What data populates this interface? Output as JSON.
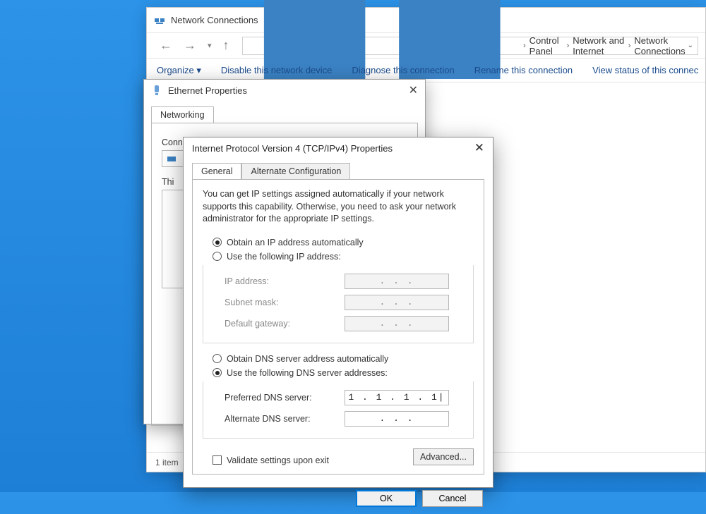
{
  "mainWindow": {
    "title": "Network Connections",
    "breadcrumb": {
      "root": "Control Panel",
      "mid": "Network and Internet",
      "leaf": "Network Connections"
    },
    "toolbar": {
      "organize": "Organize ▾",
      "disable": "Disable this network device",
      "diagnose": "Diagnose this connection",
      "rename": "Rename this connection",
      "viewstatus": "View status of this connec"
    },
    "status": "1 item"
  },
  "ethernetDialog": {
    "title": "Ethernet Properties",
    "tab": "Networking",
    "connectUsing": "Connect using:",
    "itemsLabel": "Thi"
  },
  "ipv4": {
    "title": "Internet Protocol Version 4 (TCP/IPv4) Properties",
    "tabs": {
      "general": "General",
      "alt": "Alternate Configuration"
    },
    "description": "You can get IP settings assigned automatically if your network supports this capability. Otherwise, you need to ask your network administrator for the appropriate IP settings.",
    "ip": {
      "auto": "Obtain an IP address automatically",
      "manual": "Use the following IP address:",
      "address": "IP address:",
      "mask": "Subnet mask:",
      "gateway": "Default gateway:",
      "blank": ".       .       ."
    },
    "dns": {
      "auto": "Obtain DNS server address automatically",
      "manual": "Use the following DNS server addresses:",
      "preferred": "Preferred DNS server:",
      "alternate": "Alternate DNS server:",
      "preferredValue": "1  .  1  .  1  .  1|",
      "blank": ".       .       ."
    },
    "validate": "Validate settings upon exit",
    "advanced": "Advanced...",
    "ok": "OK",
    "cancel": "Cancel"
  }
}
